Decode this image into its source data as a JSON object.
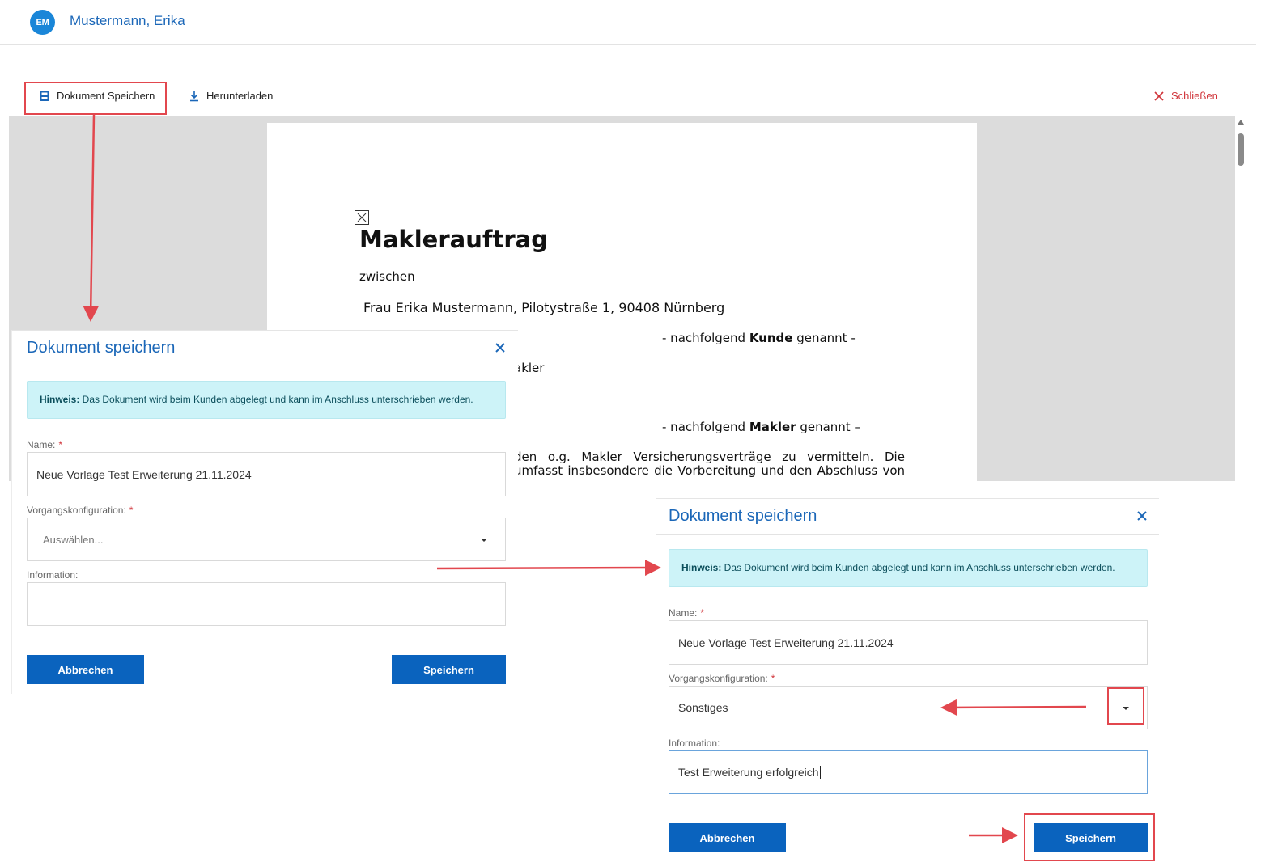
{
  "header": {
    "avatar_initials": "EM",
    "user_name": "Mustermann, Erika"
  },
  "toolbar": {
    "save_label": "Dokument Speichern",
    "download_label": "Herunterladen",
    "close_label": "Schließen"
  },
  "document": {
    "title": "Maklerauftrag",
    "line_between": "zwischen",
    "line_customer": "Frau Erika Mustermann, Pilotystraße 1, 90408 Nürnberg",
    "customer_suffix_pre": "- nachfolgend ",
    "customer_suffix_bold": "Kunde",
    "customer_suffix_post": " genannt -",
    "line_makler_fragment": "akler",
    "makler_suffix_pre": "- nachfolgend ",
    "makler_suffix_bold": "Makler",
    "makler_suffix_post": " genannt –",
    "para_line1_words": [
      "den",
      "o.g.",
      "Makler",
      "Versicherungsverträge",
      "zu",
      "vermitteln.",
      "Die"
    ],
    "para_line2_words": [
      "umfasst",
      "insbesondere",
      "die",
      "Vorbereitung",
      "und",
      "den",
      "Abschluss",
      "von"
    ]
  },
  "dialog_empty": {
    "title": "Dokument speichern",
    "hint_bold": "Hinweis:",
    "hint_text": " Das Dokument wird beim Kunden abgelegt und kann im Anschluss unterschrieben werden.",
    "name_label": "Name:",
    "name_value": "Neue Vorlage Test Erweiterung 21.11.2024",
    "config_label": "Vorgangskonfiguration:",
    "config_placeholder": "Auswählen...",
    "info_label": "Information:",
    "info_value": "",
    "cancel_label": "Abbrechen",
    "save_label": "Speichern"
  },
  "dialog_filled": {
    "title": "Dokument speichern",
    "hint_bold": "Hinweis:",
    "hint_text": " Das Dokument wird beim Kunden abgelegt und kann im Anschluss unterschrieben werden.",
    "name_label": "Name:",
    "name_value": "Neue Vorlage Test Erweiterung 21.11.2024",
    "config_label": "Vorgangskonfiguration:",
    "config_value": "Sonstiges",
    "info_label": "Information:",
    "info_value": "Test Erweiterung erfolgreich",
    "cancel_label": "Abbrechen",
    "save_label": "Speichern"
  },
  "colors": {
    "primary": "#0a63be",
    "link": "#1b67b8",
    "hint_bg": "#cdf3f8",
    "annotation": "#e2474e",
    "danger": "#d0343a"
  },
  "icons": {
    "save": "floppy-disk-icon",
    "download": "download-icon",
    "close": "close-x-icon",
    "doc": "broken-image-icon"
  }
}
